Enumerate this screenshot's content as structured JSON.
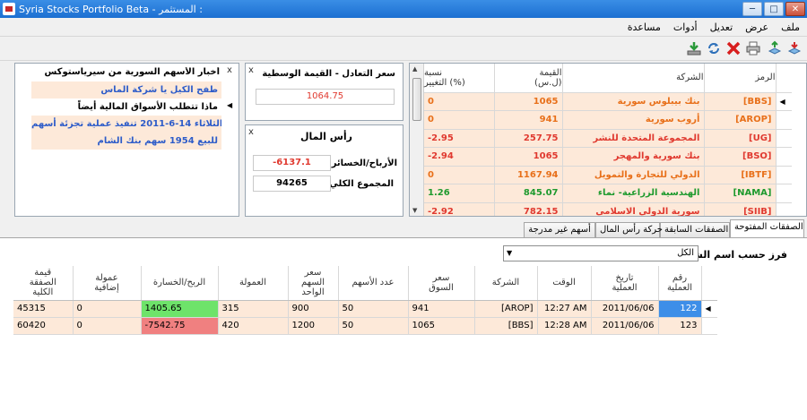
{
  "window": {
    "title": "Syria Stocks Portfolio Beta - المستثمر :"
  },
  "menu": [
    "ملف",
    "عرض",
    "تعديل",
    "أدوات",
    "مساعدة"
  ],
  "toolbar": {
    "icons": [
      "import-icon",
      "export-icon",
      "print-icon",
      "delete-icon",
      "refresh-icon",
      "download-icon"
    ]
  },
  "stocks_grid": {
    "headers": {
      "symbol": "الرمز",
      "company": "الشركة",
      "value": "القيمة (ل.س)",
      "value_l1": "القيمة",
      "value_l2": "(ل.س)",
      "change_l1": "نسبة",
      "change_l2": "التغيير (%)"
    },
    "rows": [
      {
        "symbol": "[BBS]",
        "company": "بنك بيبلوس سورية",
        "value": "1065",
        "change": "0",
        "tone": "orange"
      },
      {
        "symbol": "[AROP]",
        "company": "أروب سورية",
        "value": "941",
        "change": "0",
        "tone": "orange"
      },
      {
        "symbol": "[UG]",
        "company": "المجموعة المتحدة للنشر",
        "value": "257.75",
        "change": "-2.95",
        "tone": "red"
      },
      {
        "symbol": "[BSO]",
        "company": "بنك سورية والمهجر",
        "value": "1065",
        "change": "-2.94",
        "tone": "red"
      },
      {
        "symbol": "[IBTF]",
        "company": "الدولي للتجارة والتمويل",
        "value": "1167.94",
        "change": "0",
        "tone": "orange"
      },
      {
        "symbol": "[NAMA]",
        "company": "الهندسية الزراعية- نماء",
        "value": "845.07",
        "change": "1.26",
        "tone": "green"
      },
      {
        "symbol": "[SIIB]",
        "company": "سورية الدولي الاسلامي",
        "value": "782.15",
        "change": "-2.92",
        "tone": "red"
      }
    ]
  },
  "exchange_panel": {
    "title": "سعر التعادل - القيمة الوسطية",
    "value": "1064.75"
  },
  "capital_panel": {
    "title": "رأس المال",
    "pl_label": "الأرباح/الخسائر",
    "pl_value": "-6137.1",
    "total_label": "المجموع الكلي",
    "total_value": "94265"
  },
  "news_panel": {
    "title": "أخبار الأسهم السورية من سيرياستوكس",
    "items": [
      "طفح الكيل يا شركة الماس",
      "ماذا تتطلب الأسواق المالية أيضاً",
      "الثلاثاء 14-6-2011 تنفيذ عملية تجزئة أسهم...",
      "للبيع 1954 سهم بنك الشام"
    ]
  },
  "tabs": [
    "الصفقات المفتوحة",
    "الصفقات السابقة",
    "حركة رأس المال",
    "أسهم غير مدرجة"
  ],
  "filter": {
    "label": "فرز حسب اسم الشركة",
    "value": "الكل"
  },
  "trades": {
    "headers": [
      "رقم العملية",
      "تاريخ العملية",
      "الوقت",
      "الشركة",
      "سعر السوق",
      "عدد الأسهم",
      "سعر السهم الواحد",
      "العمولة",
      "الربح/الخسارة",
      "عمولة إضافية",
      "قيمة الصفقة الكلية"
    ],
    "header_lines": [
      [
        "رقم العملية"
      ],
      [
        "تاريخ",
        "العملية"
      ],
      [
        "الوقت"
      ],
      [
        "الشركة"
      ],
      [
        "سعر",
        "السوق"
      ],
      [
        "عدد الأسهم"
      ],
      [
        "سعر",
        "السهم",
        "الواحد"
      ],
      [
        "العمولة"
      ],
      [
        "الربح/الخسارة"
      ],
      [
        "عمولة",
        "إضافية"
      ],
      [
        "قيمة",
        "الصفقة",
        "الكلية"
      ]
    ],
    "rows": [
      {
        "id": "122",
        "date": "2011/06/06",
        "time": "12:27 AM",
        "company": "[AROP]",
        "market": "941",
        "shares": "50",
        "unit_price": "900",
        "commission": "315",
        "pl": "1405.65",
        "pl_sign": "pos",
        "extra": "0",
        "total": "45315"
      },
      {
        "id": "123",
        "date": "2011/06/06",
        "time": "12:28 AM",
        "company": "[BBS]",
        "market": "1065",
        "shares": "50",
        "unit_price": "1200",
        "commission": "420",
        "pl": "-7542.75",
        "pl_sign": "neg",
        "extra": "0",
        "total": "60420"
      }
    ]
  }
}
